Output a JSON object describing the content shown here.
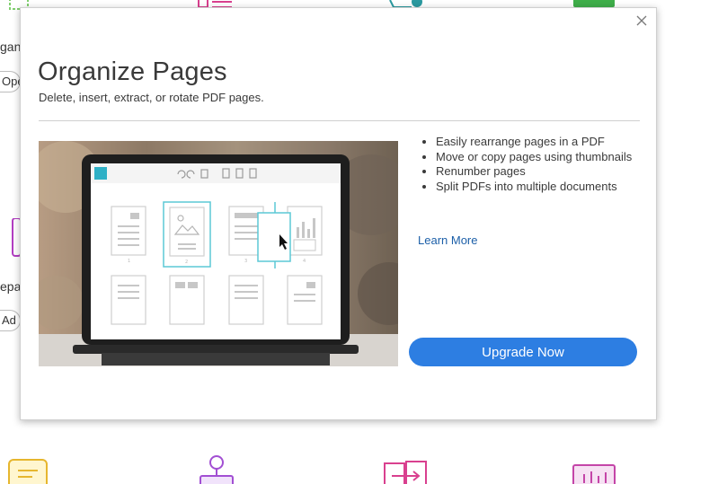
{
  "background": {
    "partial_texts": [
      "gan",
      "Ope",
      "epa",
      "Ad"
    ]
  },
  "modal": {
    "title": "Organize Pages",
    "subtitle": "Delete, insert, extract, or rotate PDF pages.",
    "close_icon": "close-icon",
    "features": [
      "Easily rearrange pages in a PDF",
      "Move or copy pages using thumbnails",
      "Renumber pages",
      "Split PDFs into multiple documents"
    ],
    "learn_more_label": "Learn More",
    "upgrade_label": "Upgrade Now",
    "hero_thumbnail_numbers": [
      "1",
      "2",
      "3",
      "4"
    ]
  },
  "colors": {
    "accent": "#2d7ee2",
    "link": "#1c5fa8",
    "thumbnail_highlight": "#5bc8d6"
  }
}
